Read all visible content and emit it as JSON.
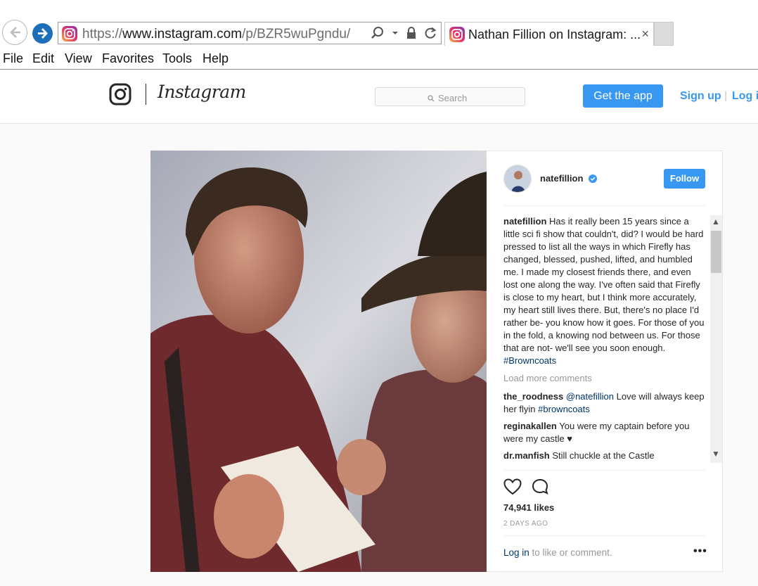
{
  "browser": {
    "url_prefix": "https://",
    "url_host": "www.instagram.com",
    "url_path": "/p/BZR5wuPgndu/",
    "tab_title": "Nathan Fillion on Instagram: ...",
    "tab_close": "×",
    "menu": [
      "File",
      "Edit",
      "View",
      "Favorites",
      "Tools",
      "Help"
    ]
  },
  "header": {
    "wordmark": "Instagram",
    "search_placeholder": "Search",
    "get_app": "Get the app",
    "sign_up": "Sign up",
    "separator": "|",
    "log_in": "Log in"
  },
  "post": {
    "username": "natefillion",
    "follow": "Follow",
    "caption_user": "natefillion",
    "caption_text": "Has it really been 15 years since a little sci fi show that couldn't, did? I would be hard pressed to list all the ways in which Firefly has changed, blessed, pushed, lifted, and humbled me. I made my closest friends there, and even lost one along the way. I've often said that Firefly is close to my heart, but I think more accurately, my heart still lives there. But, there's no place I'd rather be- you know how it goes. For those of you in the fold, a knowing nod between us. For those that are not- we'll see you soon enough.",
    "caption_tag": "#Browncoats",
    "load_more": "Load more comments",
    "comments": [
      {
        "user": "the_roodness",
        "mention": "@natefillion",
        "text": "Love will always keep her flyin",
        "tag": "#browncoats"
      },
      {
        "user": "reginakallen",
        "mention": "",
        "text": "You were my captain before you were my castle ♥",
        "tag": ""
      },
      {
        "user": "dr.manfish",
        "mention": "",
        "text": "Still chuckle at the Castle",
        "tag": ""
      }
    ],
    "likes": "74,941 likes",
    "posted": "2 DAYS AGO",
    "login_link": "Log in",
    "login_rest": " to like or comment.",
    "more": "•••"
  },
  "colors": {
    "accent": "#3897f0",
    "link_dark": "#003569"
  },
  "icons": [
    "back-arrow-icon",
    "forward-arrow-icon",
    "instagram-favicon-icon",
    "search-icon",
    "dropdown-icon",
    "lock-icon",
    "refresh-icon",
    "verified-badge-icon",
    "heart-icon",
    "comment-icon"
  ]
}
